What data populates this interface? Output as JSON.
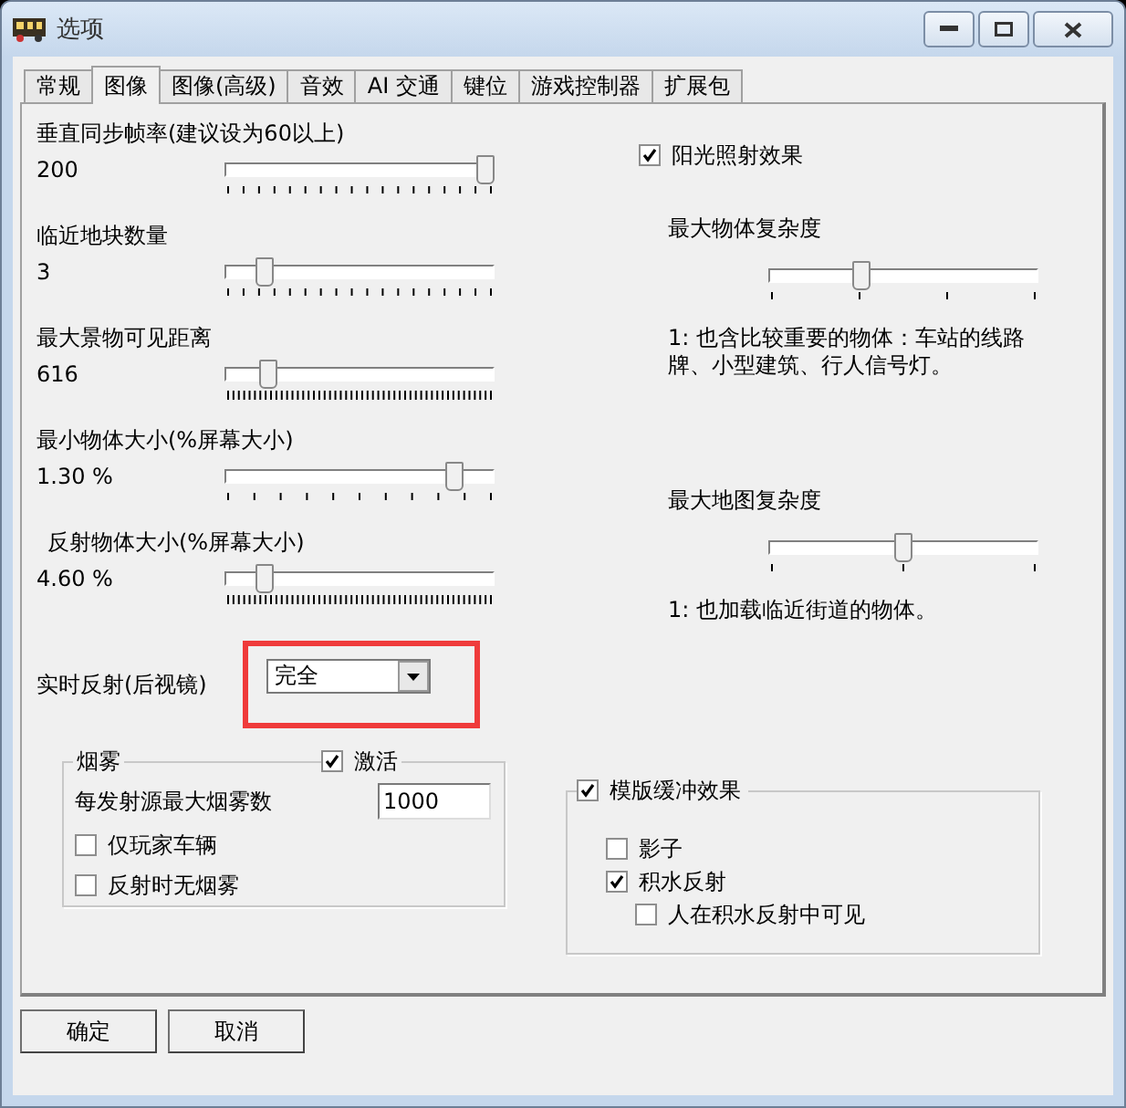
{
  "window": {
    "title": "选项"
  },
  "tabs": [
    {
      "label": "常规",
      "selected": false
    },
    {
      "label": "图像",
      "selected": true
    },
    {
      "label": "图像(高级)",
      "selected": false
    },
    {
      "label": "音效",
      "selected": false
    },
    {
      "label": "AI 交通",
      "selected": false
    },
    {
      "label": "键位",
      "selected": false
    },
    {
      "label": "游戏控制器",
      "selected": false
    },
    {
      "label": "扩展包",
      "selected": false
    }
  ],
  "sliders": [
    {
      "label": "垂直同步帧率(建议设为60以上)",
      "value": "200",
      "level": 1.0
    },
    {
      "label": "临近地块数量",
      "value": "3",
      "level": 0.12
    },
    {
      "label": "最大景物可见距离",
      "value": "616",
      "level": 0.14
    },
    {
      "label": "最小物体大小(%屏幕大小)",
      "value": "1.30 %",
      "level": 0.88
    },
    {
      "label": "反射物体大小(%屏幕大小)",
      "value": "4.60 %",
      "level": 0.12
    }
  ],
  "sunlight": {
    "label": "阳光照射效果",
    "checked": true
  },
  "complexity": [
    {
      "label": "最大物体复杂度",
      "level": 0.33,
      "note": "1: 也含比较重要的物体：车站的线路牌、小型建筑、行人信号灯。"
    },
    {
      "label": "最大地图复杂度",
      "level": 0.5,
      "note": "1: 也加载临近街道的物体。"
    }
  ],
  "reflection": {
    "label": "实时反射(后视镜)",
    "value": "完全"
  },
  "fog": {
    "title": "烟雾",
    "active": {
      "label": "激活",
      "checked": true
    },
    "max_label": "每发射源最大烟雾数",
    "max_value": "1000",
    "options": [
      {
        "label": "仅玩家车辆",
        "checked": false
      },
      {
        "label": "反射时无烟雾",
        "checked": false
      }
    ]
  },
  "stencil": {
    "label": "模版缓冲效果",
    "checked": true,
    "options": [
      {
        "label": "影子",
        "checked": false
      },
      {
        "label": "积水反射",
        "checked": true,
        "children": [
          {
            "label": "人在积水反射中可见",
            "checked": false
          }
        ]
      }
    ]
  },
  "buttons": [
    "确定",
    "取消"
  ]
}
